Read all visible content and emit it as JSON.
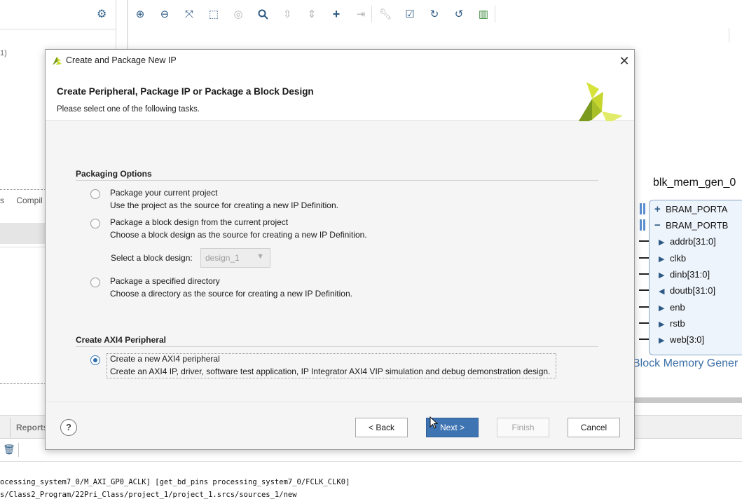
{
  "background": {
    "left_fragment": "1)",
    "left_tabs": [
      "s",
      "Compil"
    ],
    "toolbar_icons": [
      "zoom-in-icon",
      "zoom-out-icon",
      "fit-view-icon",
      "fit-selection-icon",
      "select-area-icon",
      "search-icon",
      "collapse-icon",
      "expand-icon",
      "add-icon",
      "add-module-icon",
      "wrench-icon",
      "validate-icon",
      "refresh-icon",
      "regenerate-icon",
      "memory-icon"
    ],
    "block": {
      "title": "blk_mem_gen_0",
      "ports": [
        {
          "sign": "+",
          "label": "BRAM_PORTA"
        },
        {
          "sign": "−",
          "label": "BRAM_PORTB"
        }
      ],
      "pins": [
        {
          "dir": "in",
          "label": "addrb[31:0]"
        },
        {
          "dir": "in",
          "label": "clkb"
        },
        {
          "dir": "in",
          "label": "dinb[31:0]"
        },
        {
          "dir": "out",
          "label": "doutb[31:0]"
        },
        {
          "dir": "in",
          "label": "enb"
        },
        {
          "dir": "in",
          "label": "rstb"
        },
        {
          "dir": "in",
          "label": "web[3:0]"
        }
      ],
      "subtitle": "Block Memory Gener"
    },
    "reports_tab": "Reports",
    "console_lines": [
      "ocessing_system7_0/M_AXI_GP0_ACLK] [get_bd_pins processing_system7_0/FCLK_CLK0]",
      "s/Class2_Program/22Pri_Class/project_1/project_1.srcs/sources_1/new"
    ]
  },
  "dialog": {
    "title": "Create and Package New IP",
    "header_title": "Create Peripheral, Package IP or Package a Block Design",
    "header_subtitle": "Please select one of the following tasks.",
    "packaging": {
      "section_title": "Packaging Options",
      "options": [
        {
          "label": "Package your current project",
          "desc": "Use the project as the source for creating a new IP Definition.",
          "checked": false
        },
        {
          "label": "Package a block design from the current project",
          "desc": "Choose a block design as the source for creating a new IP Definition.",
          "checked": false
        },
        {
          "label": "Package a specified directory",
          "desc": "Choose a directory as the source for creating a new IP Definition.",
          "checked": false
        }
      ],
      "block_design_label": "Select a block design:",
      "block_design_value": "design_1"
    },
    "axi": {
      "section_title": "Create AXI4 Peripheral",
      "label": "Create a new AXI4 peripheral",
      "desc": "Create an AXI4 IP, driver, software test application, IP Integrator AXI4 VIP simulation and debug demonstration design.",
      "checked": true
    },
    "buttons": {
      "help": "?",
      "back": "< Back",
      "next": "Next >",
      "finish": "Finish",
      "cancel": "Cancel"
    }
  },
  "colors": {
    "accent": "#3f74b3",
    "icon_blue": "#2d5a84",
    "logo_yellow": "#d6e33a",
    "logo_green": "#7a9a1f"
  }
}
